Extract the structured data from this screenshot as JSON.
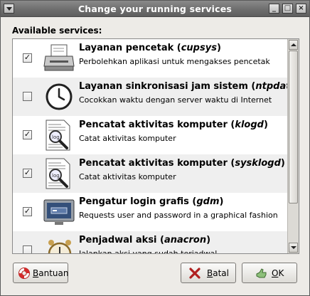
{
  "window": {
    "title": "Change your running services"
  },
  "section_label": "Available services:",
  "services": [
    {
      "checked": true,
      "alt": false,
      "icon": "printer-icon",
      "title": "Layanan pencetak (",
      "name": "cupsys",
      "close": ")",
      "desc": "Perbolehkan aplikasi untuk mengakses pencetak"
    },
    {
      "checked": false,
      "alt": true,
      "icon": "clock-icon",
      "title": "Layanan sinkronisasi jam sistem (",
      "name": "ntpdate",
      "close": ")",
      "desc": "Cocokkan waktu dengan server waktu di Internet"
    },
    {
      "checked": true,
      "alt": false,
      "icon": "log-magnifier-icon",
      "title": "Pencatat aktivitas komputer (",
      "name": "klogd",
      "close": ")",
      "desc": "Catat aktivitas komputer"
    },
    {
      "checked": true,
      "alt": true,
      "icon": "log-magnifier-icon",
      "title": "Pencatat aktivitas komputer (",
      "name": "sysklogd",
      "close": ")",
      "desc": "Catat aktivitas komputer"
    },
    {
      "checked": true,
      "alt": false,
      "icon": "monitor-login-icon",
      "title": "Pengatur login grafis (",
      "name": "gdm",
      "close": ")",
      "desc": "Requests user and password in a graphical fashion"
    },
    {
      "checked": false,
      "alt": true,
      "icon": "alarm-clock-icon",
      "title": "Penjadwal aksi (",
      "name": "anacron",
      "close": ")",
      "desc": "Jalankan aksi yang sudah terjadwal"
    }
  ],
  "buttons": {
    "help": {
      "underline": "B",
      "rest": "antuan",
      "icon": "lifebuoy-icon"
    },
    "cancel": {
      "underline": "B",
      "rest": "atal",
      "icon": "cancel-x-icon"
    },
    "ok": {
      "underline": "O",
      "rest": "K",
      "icon": "ok-hand-icon"
    }
  },
  "colors": {
    "titlebar": "#6e6e6e",
    "row_alt": "#efefef",
    "window_bg": "#edebe7"
  }
}
